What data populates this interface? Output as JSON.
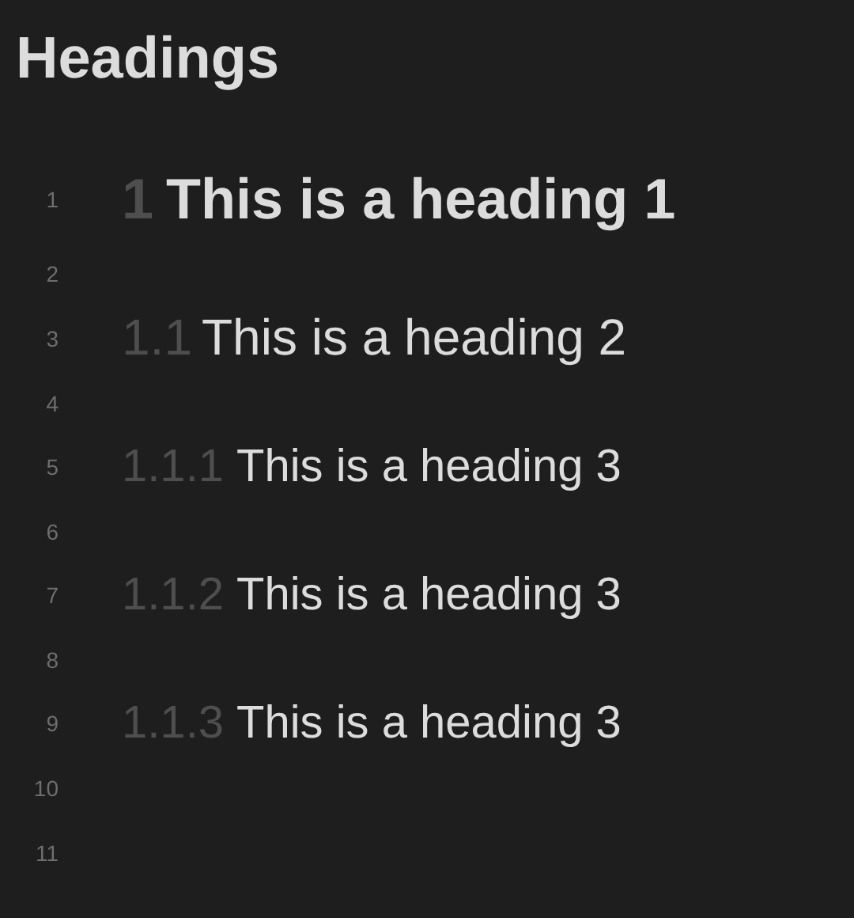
{
  "title": "Headings",
  "lines": [
    {
      "number": "1",
      "kind": "h1",
      "prefix": "1",
      "text": "This is a heading 1"
    },
    {
      "number": "2",
      "kind": "empty"
    },
    {
      "number": "3",
      "kind": "h2",
      "prefix": "1.1",
      "text": "This is a heading 2"
    },
    {
      "number": "4",
      "kind": "empty"
    },
    {
      "number": "5",
      "kind": "h3",
      "prefix": "1.1.1",
      "text": "This is a heading 3"
    },
    {
      "number": "6",
      "kind": "empty"
    },
    {
      "number": "7",
      "kind": "h3",
      "prefix": "1.1.2",
      "text": "This is a heading 3"
    },
    {
      "number": "8",
      "kind": "empty"
    },
    {
      "number": "9",
      "kind": "h3",
      "prefix": "1.1.3",
      "text": "This is a heading 3"
    },
    {
      "number": "10",
      "kind": "empty"
    },
    {
      "number": "11",
      "kind": "empty"
    }
  ]
}
